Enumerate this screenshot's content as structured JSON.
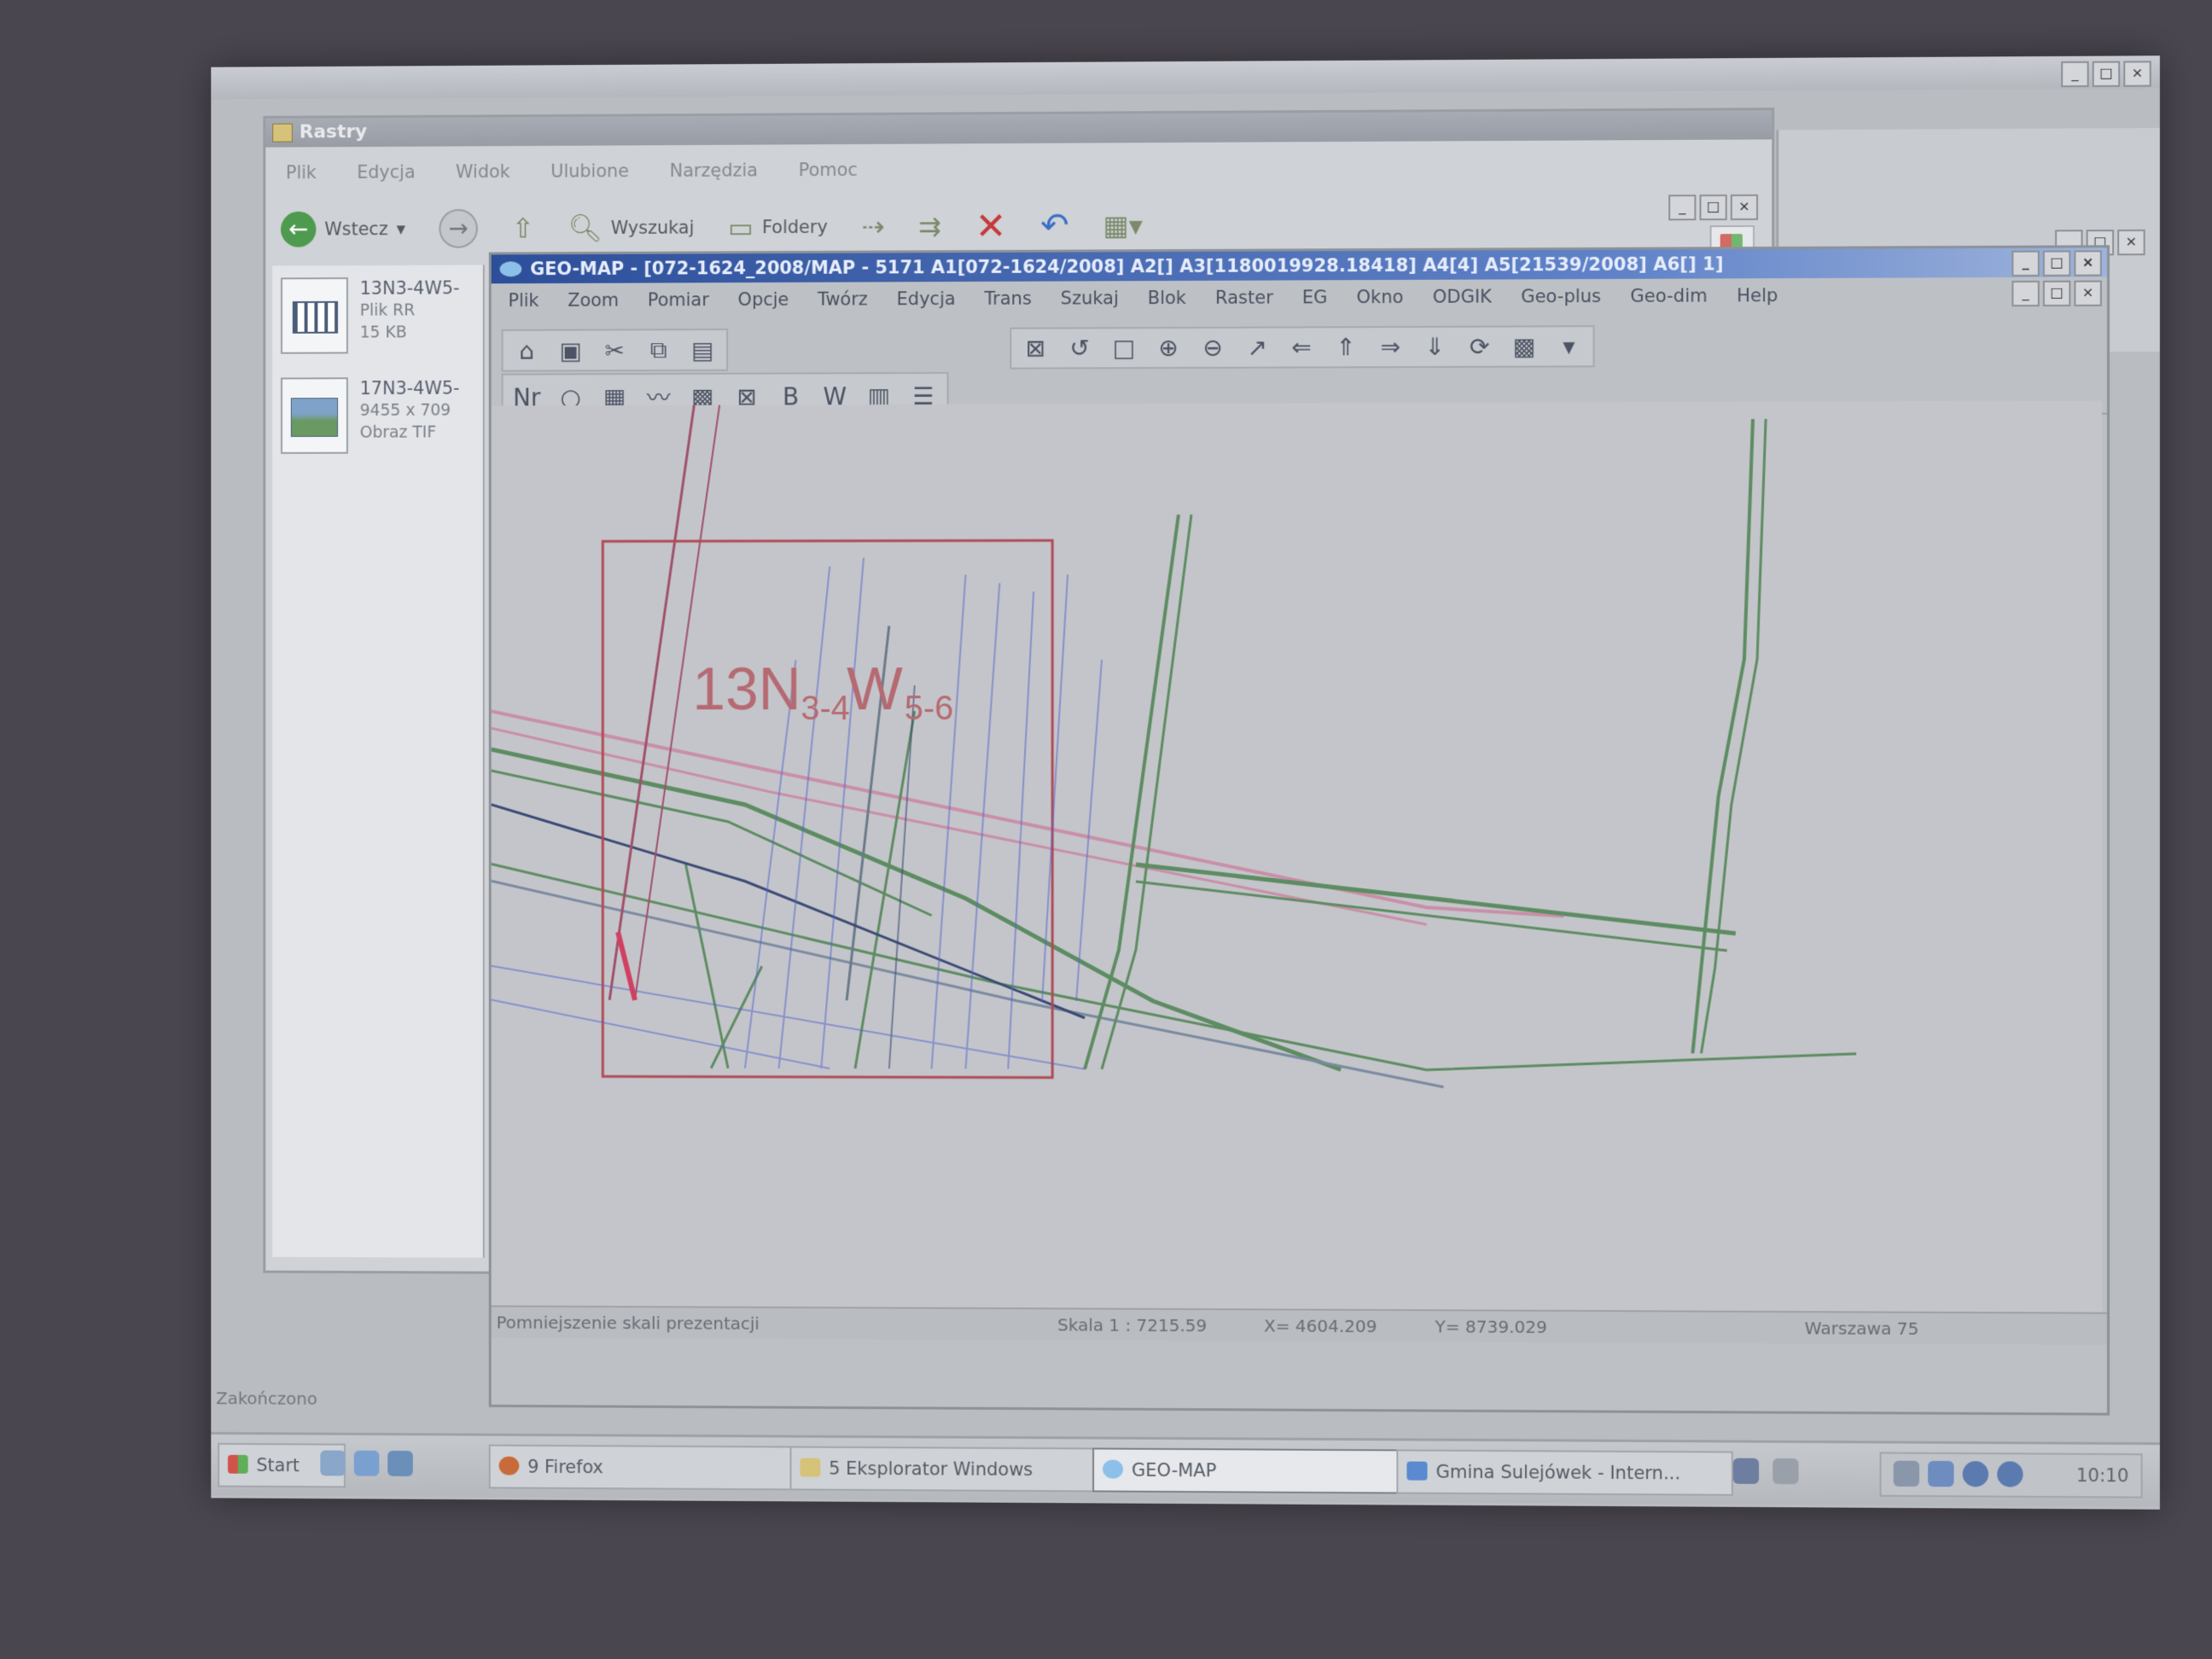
{
  "explorer": {
    "title": "Rastry",
    "menu": [
      "Plik",
      "Edycja",
      "Widok",
      "Ulubione",
      "Narzędzia",
      "Pomoc"
    ],
    "nav": {
      "back": "Wstecz",
      "search": "Wyszukaj",
      "folders": "Foldery"
    },
    "files": [
      {
        "name": "13N3-4W5-",
        "type": "Plik RR",
        "size": "15 KB"
      },
      {
        "name": "17N3-4W5-",
        "type": "9455 x 709",
        "size": "Obraz TIF"
      }
    ],
    "status": "Zakończono"
  },
  "geomap": {
    "title": "GEO-MAP - [072-1624_2008/MAP - 5171 A1[072-1624/2008] A2[] A3[1180019928.18418] A4[4] A5[21539/2008] A6[] 1]",
    "menu": [
      "Plik",
      "Zoom",
      "Pomiar",
      "Opcje",
      "Twórz",
      "Edycja",
      "Trans",
      "Szukaj",
      "Blok",
      "Raster",
      "EG",
      "Okno",
      "ODGIK",
      "Geo-plus",
      "Geo-dim",
      "Help"
    ],
    "map_label_main": "13N",
    "map_label_sub1": "3-4",
    "map_label_mid": "W",
    "map_label_sub2": "5-6",
    "status": {
      "message": "Pomniejszenie skali prezentacji",
      "scale": "Skala 1 : 7215.59",
      "x": "X=   4604.209",
      "y": "Y=   8739.029",
      "system": "Warszawa 75"
    }
  },
  "taskbar": {
    "start": "Start",
    "buttons": [
      "9 Firefox",
      "5 Eksplorator Windows",
      "GEO-MAP",
      "Gmina Sulejówek - Intern..."
    ],
    "clock": "10:10"
  }
}
